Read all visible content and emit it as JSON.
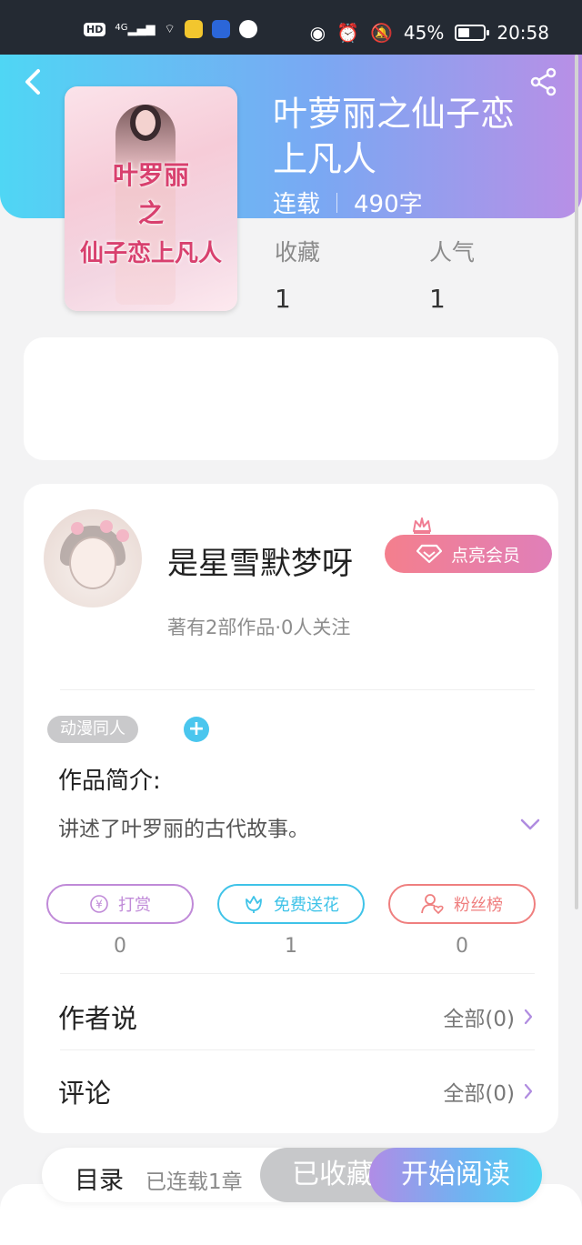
{
  "status_bar": {
    "network": "HD",
    "signal": "4G",
    "battery_percent": "45%",
    "time": "20:58"
  },
  "book": {
    "title": "叶萝丽之仙子恋上凡人",
    "status": "连载",
    "word_count": "490字",
    "cover_text_line1": "叶罗丽",
    "cover_text_line2": "之",
    "cover_text_line3": "仙子恋上凡人",
    "stats": [
      {
        "label": "收藏",
        "value": "1"
      },
      {
        "label": "人气",
        "value": "1"
      }
    ]
  },
  "author": {
    "name": "是星雪默梦呀",
    "vip_label": "点亮会员",
    "works_info": "著有2部作品·0人关注"
  },
  "tags": [
    "动漫同人"
  ],
  "tag_add": "+",
  "intro": {
    "title": "作品简介:",
    "text": "讲述了叶罗丽的古代故事。"
  },
  "actions": [
    {
      "label": "打赏",
      "count": "0",
      "color": "#c08ad8"
    },
    {
      "label": "免费送花",
      "count": "1",
      "color": "#3fc3e8"
    },
    {
      "label": "粉丝榜",
      "count": "0",
      "color": "#ef7f7f"
    }
  ],
  "sections": [
    {
      "title": "作者说",
      "link": "全部(0)"
    },
    {
      "title": "评论",
      "link": "全部(0)"
    }
  ],
  "bottom_bar": {
    "toc_label": "目录",
    "toc_sub": "已连载1章",
    "saved_label": "已收藏",
    "read_label": "开始阅读"
  },
  "colors": {
    "header_gradient_start": "#4fd6f4",
    "header_gradient_end": "#b98fe6",
    "vip_gradient_start": "#f47f8d",
    "tag_add": "#4ac6ee"
  }
}
